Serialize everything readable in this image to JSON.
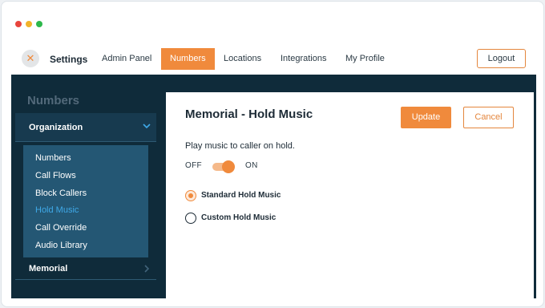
{
  "window": {
    "dots": [
      "#e8453c",
      "#f2b32a",
      "#2db84b"
    ]
  },
  "topbar": {
    "close_glyph": "✕",
    "title": "Settings",
    "tabs": [
      {
        "label": "Admin Panel"
      },
      {
        "label": "Numbers",
        "active": true
      },
      {
        "label": "Locations"
      },
      {
        "label": "Integrations"
      },
      {
        "label": "My Profile"
      }
    ],
    "logout_label": "Logout"
  },
  "sidebar": {
    "heading": "Numbers",
    "section": "Organization",
    "items": [
      {
        "label": "Numbers"
      },
      {
        "label": "Call Flows"
      },
      {
        "label": "Block Callers"
      },
      {
        "label": "Hold Music",
        "active": true
      },
      {
        "label": "Call Override"
      },
      {
        "label": "Audio Library"
      }
    ],
    "section2": "Memorial"
  },
  "panel": {
    "title": "Memorial - Hold Music",
    "update_label": "Update",
    "cancel_label": "Cancel",
    "description": "Play music to caller on hold.",
    "toggle": {
      "off_label": "OFF",
      "on_label": "ON",
      "state": "on"
    },
    "options": [
      {
        "label": "Standard Hold Music",
        "checked": true
      },
      {
        "label": "Custom Hold Music",
        "checked": false
      }
    ]
  },
  "colors": {
    "accent": "#f08a3c",
    "dark_bg": "#0f2b3a",
    "active_link": "#3fa9e8"
  }
}
